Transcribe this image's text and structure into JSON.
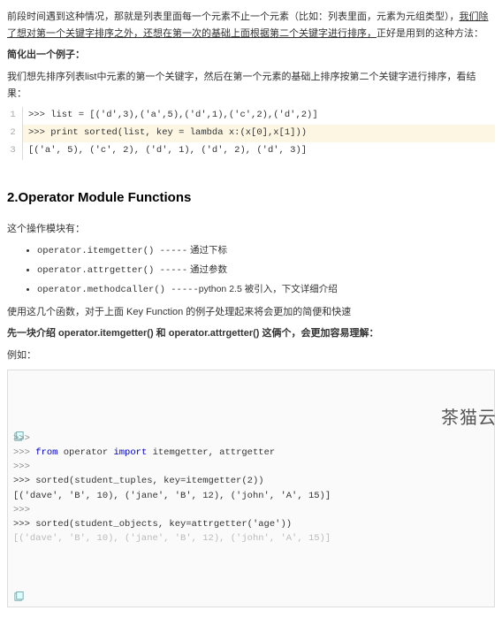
{
  "intro": {
    "p1_a": "前段时间遇到这种情况，那就是列表里面每一个元素不止一个元素（比如：列表里面，元素为元组类型），",
    "p1_b": "我们除了想对第一个关键字排序之外，还想在第一次的基础上面根据第二个关键字进行排序，",
    "p1_c": "正好是用到的这种方法：",
    "p2": "简化出一个例子：",
    "p3": "我们想先排序列表list中元素的第一个关键字，然后在第一个元素的基础上排序按第二个关键字进行排序，看结果："
  },
  "code1": {
    "lines": [
      ">>> list = [('d',3),('a',5),('d',1),('c',2),('d',2)]",
      ">>> print sorted(list, key = lambda x:(x[0],x[1]))",
      "[('a', 5), ('c', 2), ('d', 1), ('d', 2), ('d', 3)]"
    ]
  },
  "section2": {
    "heading": "2.Operator Module Functions",
    "p1": "这个操作模块有：",
    "items": [
      {
        "code": "operator.itemgetter()",
        "dash": "   -----",
        "note": " 通过下标"
      },
      {
        "code": "operator.attrgetter()",
        "dash": "   -----",
        "note": " 通过参数"
      },
      {
        "code": "operator.methodcaller()",
        "dash": " -----",
        "note": "python 2.5 被引入，下文详细介绍"
      }
    ],
    "p2": "使用这几个函数，对于上面 Key Function 的例子处理起来将会更加的简便和快速",
    "p3": "先一块介绍 operator.itemgetter() 和 operator.attrgetter() 这俩个，会更加容易理解：",
    "p4": "例如："
  },
  "code2": {
    "l1": ">>>",
    "l2_prompt": ">>> ",
    "l2_from": "from",
    "l2_mid": " operator ",
    "l2_import": "import",
    "l2_rest": " itemgetter, attrgetter",
    "l3": ">>>",
    "l4": ">>> sorted(student_tuples, key=itemgetter(2))",
    "l5": "[('dave', 'B', 10), ('jane', 'B', 12), ('john', 'A', 15)]",
    "l6": ">>>",
    "l7": ">>> sorted(student_objects, key=attrgetter('age'))",
    "l8": "[('dave', 'B', 10), ('jane', 'B', 12), ('john', 'A', 15)]"
  },
  "watermark": "茶猫云"
}
